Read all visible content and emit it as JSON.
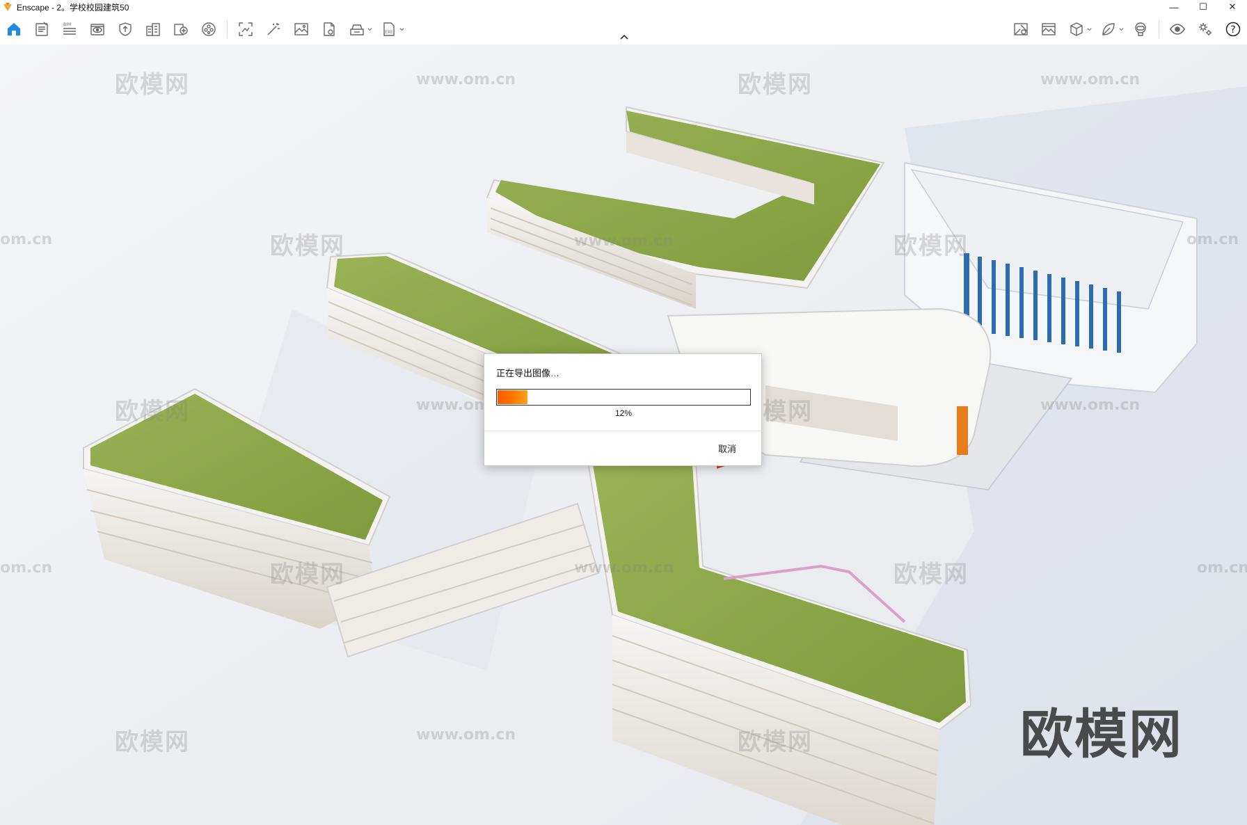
{
  "window": {
    "title": "Enscape - 2。学校校园建筑50",
    "minimize_symbol": "—",
    "maximize_symbol": "☐",
    "close_symbol": "✕"
  },
  "toolbar": {
    "left_tools": [
      {
        "name": "home-icon",
        "active": true
      },
      {
        "name": "notes-icon"
      },
      {
        "name": "bim-icon",
        "label": "BIM"
      },
      {
        "name": "view-icon"
      },
      {
        "name": "shield-icon"
      },
      {
        "name": "building-icon"
      },
      {
        "name": "asset-library-icon"
      },
      {
        "name": "material-icon"
      },
      {
        "name": "capture-icon"
      },
      {
        "name": "magic-wand-icon"
      },
      {
        "name": "screenshot-icon"
      },
      {
        "name": "render-file-icon"
      },
      {
        "name": "batch-render-icon",
        "has_dropdown": true
      },
      {
        "name": "export-exe-icon",
        "label": "EXE",
        "has_dropdown": true
      }
    ],
    "right_tools": [
      {
        "name": "map-pin-icon"
      },
      {
        "name": "image-gallery-icon"
      },
      {
        "name": "cube-icon",
        "has_dropdown": true
      },
      {
        "name": "leaf-icon",
        "has_dropdown": true
      },
      {
        "name": "vr-headset-icon"
      },
      {
        "name": "visibility-icon"
      },
      {
        "name": "settings-icon"
      },
      {
        "name": "help-icon",
        "label": "?"
      }
    ],
    "accent_color": "#1e88e5"
  },
  "dialog": {
    "title": "正在导出图像…",
    "progress_percent": 12,
    "progress_text": "12%",
    "cancel_label": "取消",
    "progress_color": "#ff6a00"
  },
  "watermarks": {
    "brand": "欧模网",
    "url": "www.om.cn",
    "url_partial": "om.cn"
  },
  "colors": {
    "roof_green": "#8ea84b",
    "building_white": "#f3f2f0",
    "window_blue": "#2e6bb5",
    "accent_orange": "#e87b1c"
  }
}
